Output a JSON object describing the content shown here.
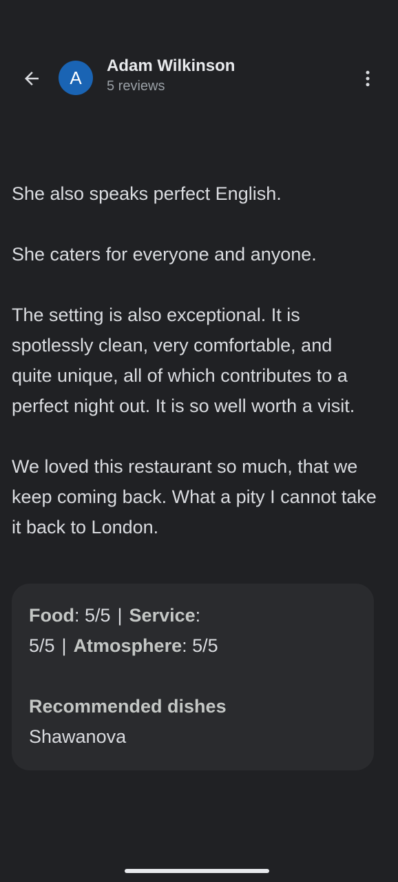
{
  "header": {
    "back_icon": "arrow-back-icon",
    "avatar_letter": "A",
    "avatar_color": "#1a64b4",
    "user_name": "Adam Wilkinson",
    "review_count": "5 reviews",
    "more_icon": "more-vert-icon"
  },
  "review": {
    "paragraphs": [
      "She also speaks perfect English.",
      "She caters for everyone and anyone.",
      "The setting is also exceptional. It is spotlessly clean, very comfortable, and quite unique, all of which contributes to a perfect night out. It is so well worth a visit.",
      "We loved this restaurant so much, that we keep coming back. What a pity I cannot take it back to London."
    ]
  },
  "ratings": {
    "food_label": "Food",
    "food_value": ": 5/5",
    "service_label": "Service",
    "service_value": ": 5/5",
    "atmosphere_label": "Atmosphere",
    "atmosphere_value": ": 5/5",
    "separator": "|"
  },
  "recommended": {
    "title": "Recommended dishes",
    "dishes": "Shawanova"
  },
  "colors": {
    "background": "#202124",
    "card_background": "#2a2b2e",
    "text": "#dadce0"
  }
}
